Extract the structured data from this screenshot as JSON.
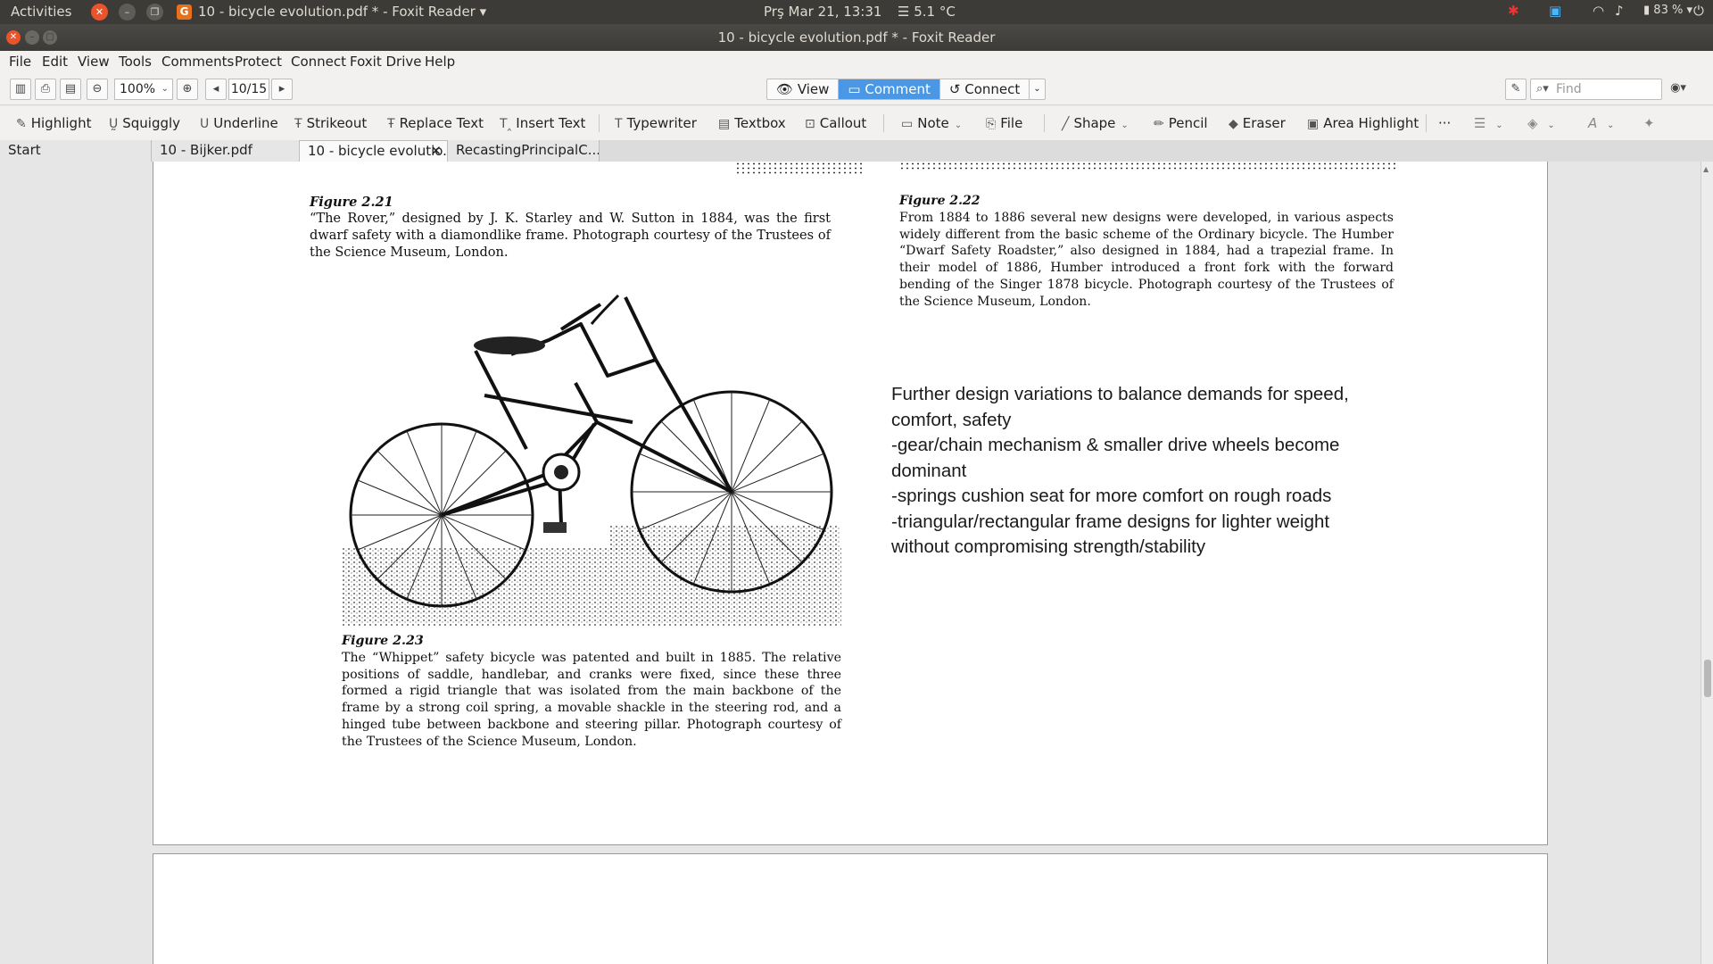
{
  "system": {
    "activities": "Activities",
    "app_title": "10 - bicycle evolution.pdf * - Foxit Reader",
    "clock": "Prş Mar 21, 13:31",
    "weather": "5.1 °C",
    "battery": "83 %"
  },
  "window": {
    "title": "10 - bicycle evolution.pdf * - Foxit Reader"
  },
  "menu": [
    "File",
    "Edit",
    "View",
    "Tools",
    "Comments",
    "Protect",
    "Connect",
    "Foxit Drive",
    "Help"
  ],
  "toolbar": {
    "zoom": "100%",
    "page": "10/15",
    "modes": [
      "View",
      "Comment",
      "Connect"
    ],
    "active_mode": "Comment",
    "find_placeholder": "Find"
  },
  "comment_tools": {
    "highlight": "Highlight",
    "squiggly": "Squiggly",
    "underline": "Underline",
    "strikeout": "Strikeout",
    "replace_text": "Replace Text",
    "insert_text": "Insert Text",
    "typewriter": "Typewriter",
    "textbox": "Textbox",
    "callout": "Callout",
    "note": "Note",
    "file": "File",
    "shape": "Shape",
    "pencil": "Pencil",
    "eraser": "Eraser",
    "area_highlight": "Area Highlight"
  },
  "tabs": [
    "Start",
    "10 - Bijker.pdf",
    "10 - bicycle evolutio...",
    "RecastingPrincipalC..."
  ],
  "active_tab": "10 - bicycle evolutio...",
  "document": {
    "fig221_label": "Figure 2.21",
    "fig221_caption": "“The Rover,” designed by J. K. Starley and W. Sutton in 1884, was the first dwarf safety with a diamondlike frame. Photograph courtesy of the Trustees of the Science Museum, London.",
    "fig222_label": "Figure 2.22",
    "fig222_caption": "From 1884 to 1886 several new designs were developed, in various aspects widely different from the basic scheme of the Ordinary bicycle. The Humber “Dwarf Safety Roadster,” also designed in 1884, had a trapezial frame. In their model of 1886, Humber introduced a front fork with the forward bending of the Singer 1878 bicycle. Photograph courtesy of the Trustees of the Science Museum, London.",
    "fig223_label": "Figure 2.23",
    "fig223_caption": "The “Whippet” safety bicycle was patented and built in 1885. The relative positions of saddle, handlebar, and cranks were fixed, since these three formed a rigid triangle that was isolated from the main backbone of the frame by a strong coil spring, a movable shackle in the steering rod, and a hinged tube between backbone and steering pillar. Photograph courtesy of the Trustees of the Science Museum, London.",
    "notes": [
      "Further design variations to balance demands for speed, comfort, safety",
      "-gear/chain mechanism & smaller drive wheels become dominant",
      "-springs cushion seat for more comfort on rough roads",
      "-triangular/rectangular frame designs for lighter weight without compromising strength/stability"
    ]
  },
  "colors": {
    "accent": "#4a97e5",
    "topbar": "#3c3b37",
    "close": "#e9542b"
  }
}
